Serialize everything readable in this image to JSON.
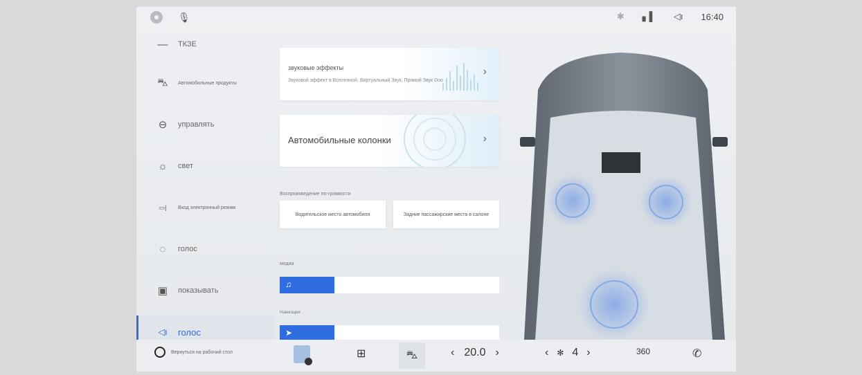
{
  "status_bar": {
    "time": "16:40",
    "icons": [
      "avatar-icon",
      "mic-icon",
      "bluetooth-icon",
      "signal-icon",
      "volume-icon"
    ]
  },
  "sidebar": {
    "items": [
      {
        "label": "ТКЗЕ",
        "icon": "shortcut-icon"
      },
      {
        "label": "Автомобильные продукты",
        "icon": "car-icon"
      },
      {
        "label": "управлять",
        "icon": "steering-wheel-icon"
      },
      {
        "label": "свет",
        "icon": "light-bulb-icon"
      },
      {
        "label": "Вход электронный режим",
        "icon": "mode-icon"
      },
      {
        "label": "голос",
        "icon": "voice-icon"
      },
      {
        "label": "показывать",
        "icon": "display-icon"
      },
      {
        "label": "голос",
        "icon": "speaker-icon",
        "active": true
      }
    ]
  },
  "main": {
    "sound_card": {
      "title": "звуковые эффекты",
      "subtitle": "Звуковой эффект в Вселенной, Виртуальный Звук, Прямой Звук Duo"
    },
    "speakers_card": {
      "title": "Автомобильные колонки"
    },
    "playback_label": "Воспроизведение по-громкости",
    "playback_buttons": [
      "Водительское место автомобиля",
      "Задние пассажирские места в салоне"
    ],
    "media_label": "медиа",
    "navigation_label": "Навигация",
    "sliders": [
      {
        "name": "media-volume",
        "value": 0.25,
        "icon": "music-note-icon"
      },
      {
        "name": "navigation-volume",
        "value": 0.25,
        "icon": "navigation-arrow-icon"
      }
    ]
  },
  "bottom_bar": {
    "power_label": "Вернуться на рабочий стол",
    "temperature": "20.0",
    "fan_speed": "4",
    "view_360": "360",
    "icons": [
      "power-icon",
      "app-icon",
      "grid-icon",
      "car-icon",
      "fan-icon",
      "phone-icon"
    ]
  },
  "colors": {
    "accent": "#2f6de1",
    "screen_bg": "#eceff2"
  }
}
